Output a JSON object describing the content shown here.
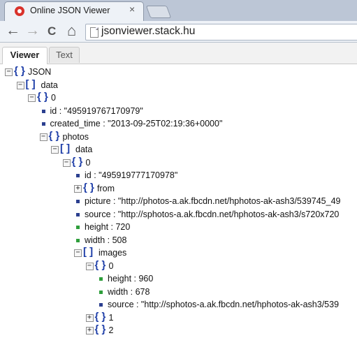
{
  "browser": {
    "tab_title": "Online JSON Viewer",
    "tab_close": "×",
    "url": "jsonviewer.stack.hu",
    "nav": {
      "back": "←",
      "forward": "→",
      "reload": "C",
      "home": "⌂"
    }
  },
  "viewer_tabs": [
    {
      "label": "Viewer",
      "active": true
    },
    {
      "label": "Text",
      "active": false
    }
  ],
  "tree": [
    {
      "kind": "object",
      "label": "JSON",
      "toggle": "−",
      "depth": 0
    },
    {
      "kind": "array",
      "label": "data",
      "toggle": "−",
      "depth": 1
    },
    {
      "kind": "object",
      "label": "0",
      "toggle": "−",
      "depth": 2
    },
    {
      "kind": "string",
      "label": "id : \"495919767170979\"",
      "depth": 3
    },
    {
      "kind": "string",
      "label": "created_time : \"2013-09-25T02:19:36+0000\"",
      "depth": 3
    },
    {
      "kind": "object",
      "label": "photos",
      "toggle": "−",
      "depth": 3
    },
    {
      "kind": "array",
      "label": "data",
      "toggle": "−",
      "depth": 4
    },
    {
      "kind": "object",
      "label": "0",
      "toggle": "−",
      "depth": 5
    },
    {
      "kind": "string",
      "label": "id : \"495919777170978\"",
      "depth": 6
    },
    {
      "kind": "object",
      "label": "from",
      "toggle": "+",
      "depth": 6
    },
    {
      "kind": "string",
      "label": "picture : \"http://photos-a.ak.fbcdn.net/hphotos-ak-ash3/539745_49",
      "depth": 6
    },
    {
      "kind": "string",
      "label": "source : \"http://sphotos-a.ak.fbcdn.net/hphotos-ak-ash3/s720x720",
      "depth": 6
    },
    {
      "kind": "number",
      "label": "height : 720",
      "depth": 6
    },
    {
      "kind": "number",
      "label": "width : 508",
      "depth": 6
    },
    {
      "kind": "array",
      "label": "images",
      "toggle": "−",
      "depth": 6
    },
    {
      "kind": "object",
      "label": "0",
      "toggle": "−",
      "depth": 7
    },
    {
      "kind": "number",
      "label": "height : 960",
      "depth": 8
    },
    {
      "kind": "number",
      "label": "width : 678",
      "depth": 8
    },
    {
      "kind": "string",
      "label": "source : \"http://sphotos-a.ak.fbcdn.net/hphotos-ak-ash3/539",
      "depth": 8
    },
    {
      "kind": "object",
      "label": "1",
      "toggle": "+",
      "depth": 7
    },
    {
      "kind": "object",
      "label": "2",
      "toggle": "+",
      "depth": 7
    }
  ]
}
